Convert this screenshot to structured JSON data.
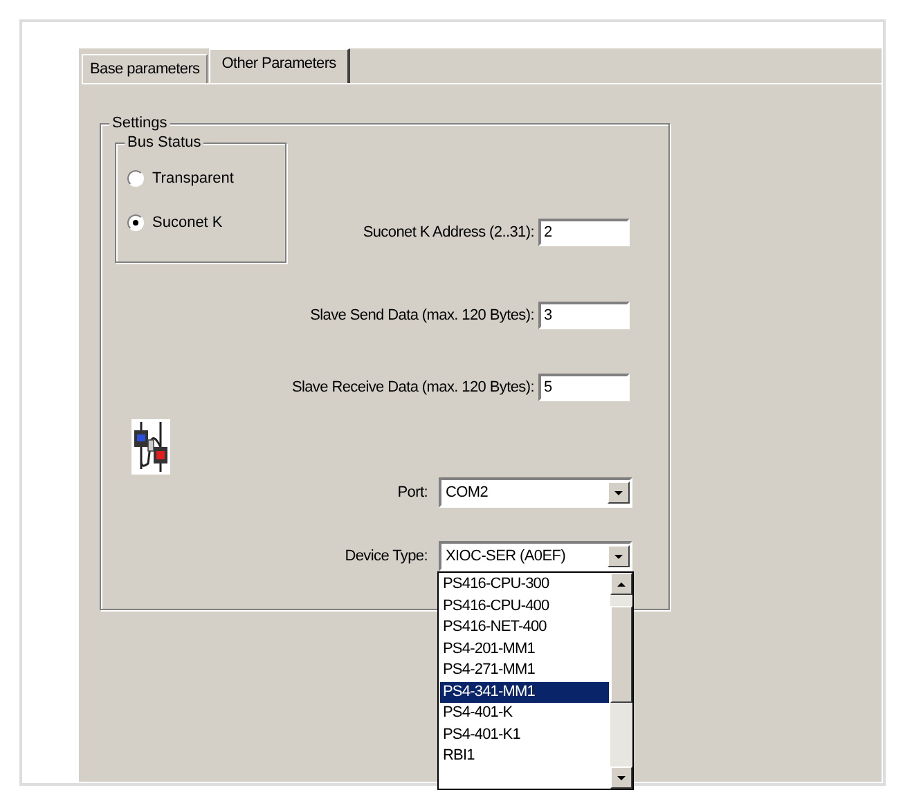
{
  "tabs": [
    {
      "label": "Base parameters",
      "selected": false
    },
    {
      "label": "Other Parameters",
      "selected": true
    }
  ],
  "settings": {
    "label": "Settings",
    "bus_status": {
      "label": "Bus Status",
      "options": [
        {
          "label": "Transparent",
          "selected": false
        },
        {
          "label": "Suconet K",
          "selected": true
        }
      ]
    },
    "fields": [
      {
        "label": "Suconet K Address (2..31):",
        "value": "2"
      },
      {
        "label": "Slave Send Data (max. 120 Bytes):",
        "value": "3"
      },
      {
        "label": "Slave Receive Data (max. 120 Bytes):",
        "value": "5"
      }
    ],
    "port": {
      "label": "Port:",
      "value": "COM2"
    },
    "device_type": {
      "label": "Device Type:",
      "value": "XIOC-SER (A0EF)",
      "expanded": true,
      "items": [
        {
          "label": "PS416-CPU-300",
          "selected": false
        },
        {
          "label": "PS416-CPU-400",
          "selected": false
        },
        {
          "label": "PS416-NET-400",
          "selected": false
        },
        {
          "label": "PS4-201-MM1",
          "selected": false
        },
        {
          "label": "PS4-271-MM1",
          "selected": false
        },
        {
          "label": "PS4-341-MM1",
          "selected": true
        },
        {
          "label": "PS4-401-K",
          "selected": false
        },
        {
          "label": "PS4-401-K1",
          "selected": false
        },
        {
          "label": "RBI1",
          "selected": false
        }
      ]
    }
  }
}
